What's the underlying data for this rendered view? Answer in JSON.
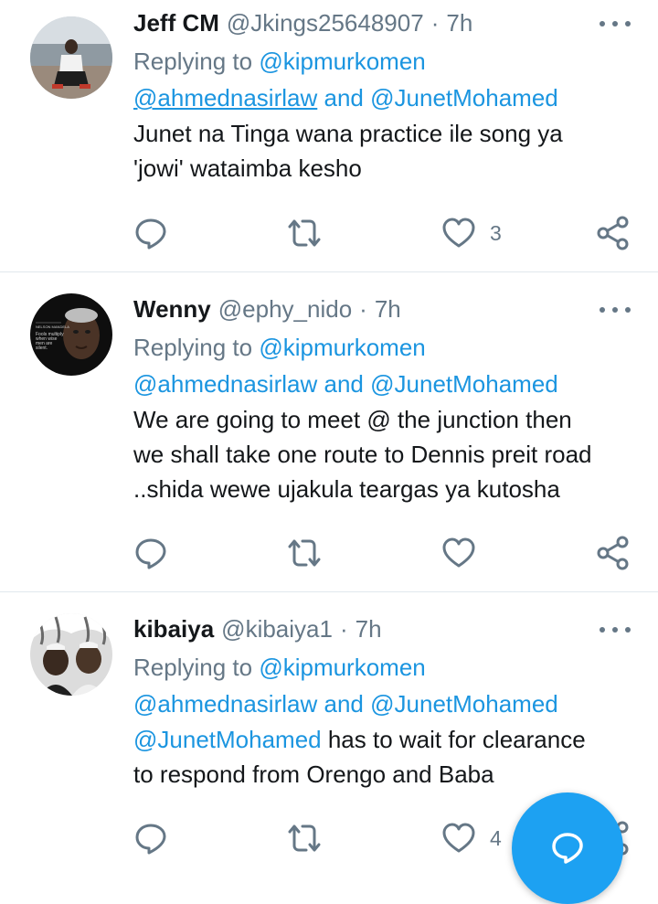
{
  "tweets": [
    {
      "name": "Jeff CM",
      "handle": "@Jkings25648907",
      "separator": "·",
      "time": "7h",
      "replying_label": "Replying to",
      "mention1": "@kipmurkomen",
      "mention2": "@ahmednasirlaw",
      "and_label": "and",
      "mention3": "@JunetMohamed",
      "body_line1": "Junet na Tinga wana practice ile song ya",
      "body_line2": "'jowi' wataimba kesho",
      "like_count": "3"
    },
    {
      "name": "Wenny",
      "handle": "@ephy_nido",
      "separator": "·",
      "time": "7h",
      "replying_label": "Replying to",
      "mention1": "@kipmurkomen",
      "mention2": "@ahmednasirlaw",
      "and_label": "and",
      "mention3": "@JunetMohamed",
      "body_line1": "We are going to meet @ the junction then",
      "body_line2": "we shall take one route to Dennis preit road",
      "body_line3": "..shida wewe ujakula teargas ya kutosha",
      "avatar_text": [
        "NELSON MANDELA",
        "Fools multiply",
        "when wise",
        "men are",
        "silent."
      ]
    },
    {
      "name": "kibaiya",
      "handle": "@kibaiya1",
      "separator": "·",
      "time": "7h",
      "replying_label": "Replying to",
      "mention1": "@kipmurkomen",
      "mention2": "@ahmednasirlaw",
      "and_label": "and",
      "mention3": "@JunetMohamed",
      "body_mention": "@JunetMohamed",
      "body_line1_rest": " has to wait for clearance",
      "body_line2": "to respond from Orengo and Baba",
      "like_count": "4"
    }
  ],
  "colors": {
    "link": "#1b95e0",
    "secondary": "#657786",
    "divider": "#e1e8ed",
    "fab": "#1da1f2"
  },
  "icons": {
    "more": "more-dots-icon",
    "reply": "reply-bubble-icon",
    "retweet": "retweet-icon",
    "like": "heart-icon",
    "share": "share-icon",
    "compose": "compose-reply-icon"
  }
}
